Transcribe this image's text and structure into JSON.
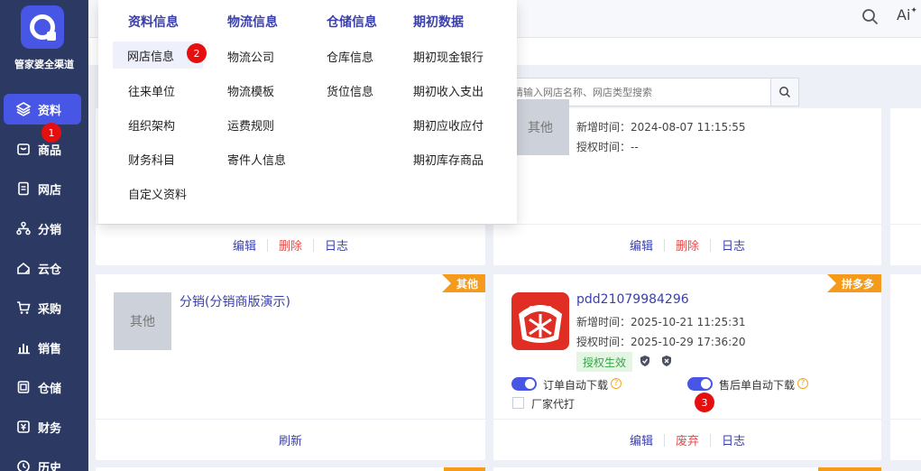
{
  "brand": {
    "name": "管家婆全渠道",
    "accent": "#4856e6"
  },
  "sidebar": {
    "items": [
      {
        "label": "资料",
        "icon": "layers-icon",
        "active": true
      },
      {
        "label": "商品",
        "icon": "goods-icon"
      },
      {
        "label": "网店",
        "icon": "document-icon"
      },
      {
        "label": "分销",
        "icon": "network-icon"
      },
      {
        "label": "云仓",
        "icon": "cloud-warehouse-icon"
      },
      {
        "label": "采购",
        "icon": "cart-icon"
      },
      {
        "label": "销售",
        "icon": "bar-chart-icon"
      },
      {
        "label": "仓储",
        "icon": "storage-icon"
      },
      {
        "label": "财务",
        "icon": "finance-icon"
      },
      {
        "label": "历史",
        "icon": "history-icon"
      }
    ]
  },
  "topbar": {
    "search_icon": "search-icon",
    "ai_label": "Ai"
  },
  "search": {
    "placeholder": "请输入网店名称、网店类型搜索"
  },
  "menu": {
    "columns": [
      {
        "title": "资料信息",
        "items": [
          "网店信息",
          "往来单位",
          "组织架构",
          "财务科目",
          "自定义资料"
        ]
      },
      {
        "title": "物流信息",
        "items": [
          "物流公司",
          "物流模板",
          "运费规则",
          "寄件人信息"
        ]
      },
      {
        "title": "仓储信息",
        "items": [
          "仓库信息",
          "货位信息"
        ]
      },
      {
        "title": "期初数据",
        "items": [
          "期初现金银行",
          "期初收入支出",
          "期初应收应付",
          "期初库存商品"
        ]
      }
    ]
  },
  "cards": {
    "top_middle": {
      "placeholder": "其他",
      "created_label": "新增时间：",
      "created": "2024-08-07 11:15:55",
      "auth_label": "授权时间：",
      "auth": "--",
      "actions": [
        "编辑",
        "删除",
        "日志"
      ]
    },
    "top_left": {
      "actions": [
        "编辑",
        "删除",
        "日志"
      ]
    },
    "fx": {
      "tag": "其他",
      "placeholder": "其他",
      "title": "分销(分销商版演示)",
      "actions": [
        "刷新"
      ]
    },
    "pdd": {
      "tag": "拼多多",
      "title": "pdd21079984296",
      "created_label": "新增时间：",
      "created": "2025-10-21 11:25:31",
      "auth_label": "授权时间：",
      "auth": "2025-10-29 17:36:20",
      "auth_status": "授权生效",
      "toggle1": "订单自动下载",
      "toggle2": "售后单自动下载",
      "checkbox": "厂家代打",
      "actions": [
        "编辑",
        "废弃",
        "日志"
      ]
    }
  },
  "badges": [
    "1",
    "2",
    "3"
  ]
}
